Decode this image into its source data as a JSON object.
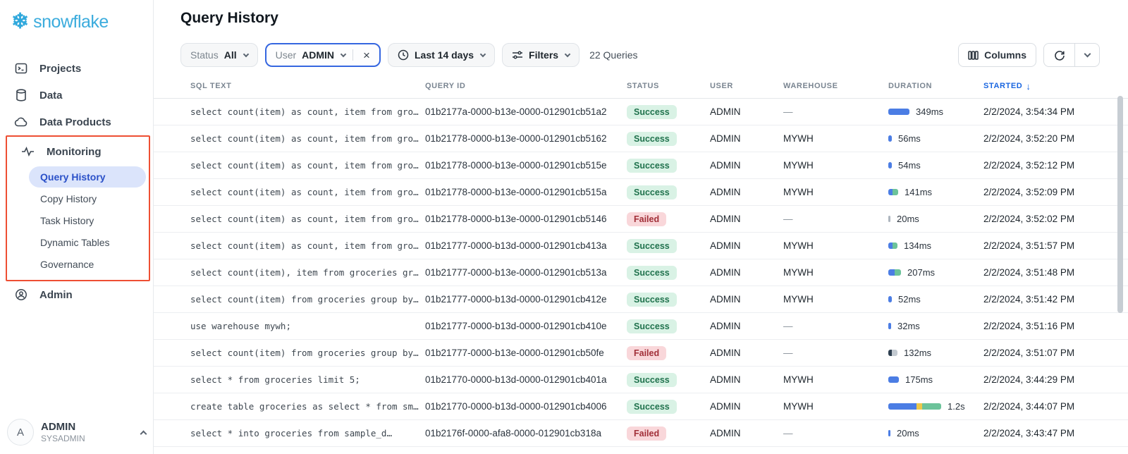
{
  "sidebar": {
    "logo_text": "snowflake",
    "items": [
      {
        "label": "Projects",
        "icon": "terminal-icon"
      },
      {
        "label": "Data",
        "icon": "database-icon"
      },
      {
        "label": "Data Products",
        "icon": "cloud-icon"
      }
    ],
    "monitoring_label": "Monitoring",
    "sub_items": [
      {
        "label": "Query History",
        "active": true
      },
      {
        "label": "Copy History",
        "active": false
      },
      {
        "label": "Task History",
        "active": false
      },
      {
        "label": "Dynamic Tables",
        "active": false
      },
      {
        "label": "Governance",
        "active": false
      }
    ],
    "admin_label": "Admin",
    "user": {
      "initial": "A",
      "name": "ADMIN",
      "role": "SYSADMIN"
    }
  },
  "header": {
    "title": "Query History"
  },
  "filters": {
    "status": {
      "label": "Status",
      "value": "All"
    },
    "user": {
      "label": "User",
      "value": "ADMIN"
    },
    "date_range": "Last 14 days",
    "filters_label": "Filters",
    "query_count": "22 Queries",
    "columns_label": "Columns"
  },
  "colors": {
    "accent_blue": "#1a66e0",
    "annotation_red": "#ee4f33",
    "success_bg": "#d9f2e5",
    "success_text": "#20724d",
    "failed_bg": "#f9d7da",
    "failed_text": "#a12f38",
    "bar_blue": "#4b7de4",
    "bar_green": "#6cc39a",
    "bar_yellow": "#ecc94b"
  },
  "table": {
    "headers": [
      "SQL TEXT",
      "QUERY ID",
      "STATUS",
      "USER",
      "WAREHOUSE",
      "DURATION",
      "STARTED"
    ],
    "sorted_column": "STARTED",
    "sort_direction": "desc",
    "rows": [
      {
        "sql": "select count(item) as count, item from gro…",
        "query_id": "01b2177a-0000-b13e-0000-012901cb51a2",
        "status": "Success",
        "user": "ADMIN",
        "warehouse": "—",
        "duration": "349ms",
        "segments": [
          [
            "#4b7de4",
            30
          ]
        ],
        "started": "2/2/2024, 3:54:34 PM"
      },
      {
        "sql": "select count(item) as count, item from gro…",
        "query_id": "01b21778-0000-b13e-0000-012901cb5162",
        "status": "Success",
        "user": "ADMIN",
        "warehouse": "MYWH",
        "duration": "56ms",
        "segments": [
          [
            "#4b7de4",
            5
          ]
        ],
        "started": "2/2/2024, 3:52:20 PM"
      },
      {
        "sql": "select count(item) as count, item from gro…",
        "query_id": "01b21778-0000-b13e-0000-012901cb515e",
        "status": "Success",
        "user": "ADMIN",
        "warehouse": "MYWH",
        "duration": "54ms",
        "segments": [
          [
            "#4b7de4",
            5
          ]
        ],
        "started": "2/2/2024, 3:52:12 PM"
      },
      {
        "sql": "select count(item) as count, item from gro…",
        "query_id": "01b21778-0000-b13e-0000-012901cb515a",
        "status": "Success",
        "user": "ADMIN",
        "warehouse": "MYWH",
        "duration": "141ms",
        "segments": [
          [
            "#4b7de4",
            6
          ],
          [
            "#6cc39a",
            8
          ]
        ],
        "started": "2/2/2024, 3:52:09 PM"
      },
      {
        "sql": "select count(item) as count, item from gro…",
        "query_id": "01b21778-0000-b13e-0000-012901cb5146",
        "status": "Failed",
        "user": "ADMIN",
        "warehouse": "—",
        "duration": "20ms",
        "segments": [
          [
            "#aeb6bf",
            3
          ]
        ],
        "started": "2/2/2024, 3:52:02 PM"
      },
      {
        "sql": "select count(item) as count, item from gro…",
        "query_id": "01b21777-0000-b13d-0000-012901cb413a",
        "status": "Success",
        "user": "ADMIN",
        "warehouse": "MYWH",
        "duration": "134ms",
        "segments": [
          [
            "#4b7de4",
            6
          ],
          [
            "#6cc39a",
            7
          ]
        ],
        "started": "2/2/2024, 3:51:57 PM"
      },
      {
        "sql": "select count(item), item from groceries gr…",
        "query_id": "01b21777-0000-b13e-0000-012901cb513a",
        "status": "Success",
        "user": "ADMIN",
        "warehouse": "MYWH",
        "duration": "207ms",
        "segments": [
          [
            "#4b7de4",
            9
          ],
          [
            "#6cc39a",
            9
          ]
        ],
        "started": "2/2/2024, 3:51:48 PM"
      },
      {
        "sql": "select count(item) from groceries group by…",
        "query_id": "01b21777-0000-b13d-0000-012901cb412e",
        "status": "Success",
        "user": "ADMIN",
        "warehouse": "MYWH",
        "duration": "52ms",
        "segments": [
          [
            "#4b7de4",
            5
          ]
        ],
        "started": "2/2/2024, 3:51:42 PM"
      },
      {
        "sql": "use warehouse mywh;",
        "query_id": "01b21777-0000-b13d-0000-012901cb410e",
        "status": "Success",
        "user": "ADMIN",
        "warehouse": "—",
        "duration": "32ms",
        "segments": [
          [
            "#4b7de4",
            4
          ]
        ],
        "started": "2/2/2024, 3:51:16 PM"
      },
      {
        "sql": "select count(item) from groceries group by…",
        "query_id": "01b21777-0000-b13e-0000-012901cb50fe",
        "status": "Failed",
        "user": "ADMIN",
        "warehouse": "—",
        "duration": "132ms",
        "segments": [
          [
            "#2e3f50",
            5
          ],
          [
            "#c3cad1",
            8
          ]
        ],
        "started": "2/2/2024, 3:51:07 PM"
      },
      {
        "sql": "select * from groceries limit 5;",
        "query_id": "01b21770-0000-b13d-0000-012901cb401a",
        "status": "Success",
        "user": "ADMIN",
        "warehouse": "MYWH",
        "duration": "175ms",
        "segments": [
          [
            "#4b7de4",
            15
          ]
        ],
        "started": "2/2/2024, 3:44:29 PM"
      },
      {
        "sql": "create table groceries as select * from sm…",
        "query_id": "01b21770-0000-b13d-0000-012901cb4006",
        "status": "Success",
        "user": "ADMIN",
        "warehouse": "MYWH",
        "duration": "1.2s",
        "segments": [
          [
            "#4b7de4",
            40
          ],
          [
            "#ecc94b",
            8
          ],
          [
            "#6cc39a",
            27
          ]
        ],
        "started": "2/2/2024, 3:44:07 PM"
      },
      {
        "sql": "select * into groceries from sample_d…",
        "query_id": "01b2176f-0000-afa8-0000-012901cb318a",
        "status": "Failed",
        "user": "ADMIN",
        "warehouse": "—",
        "duration": "20ms",
        "segments": [
          [
            "#4b7de4",
            3
          ]
        ],
        "started": "2/2/2024, 3:43:47 PM"
      }
    ]
  }
}
